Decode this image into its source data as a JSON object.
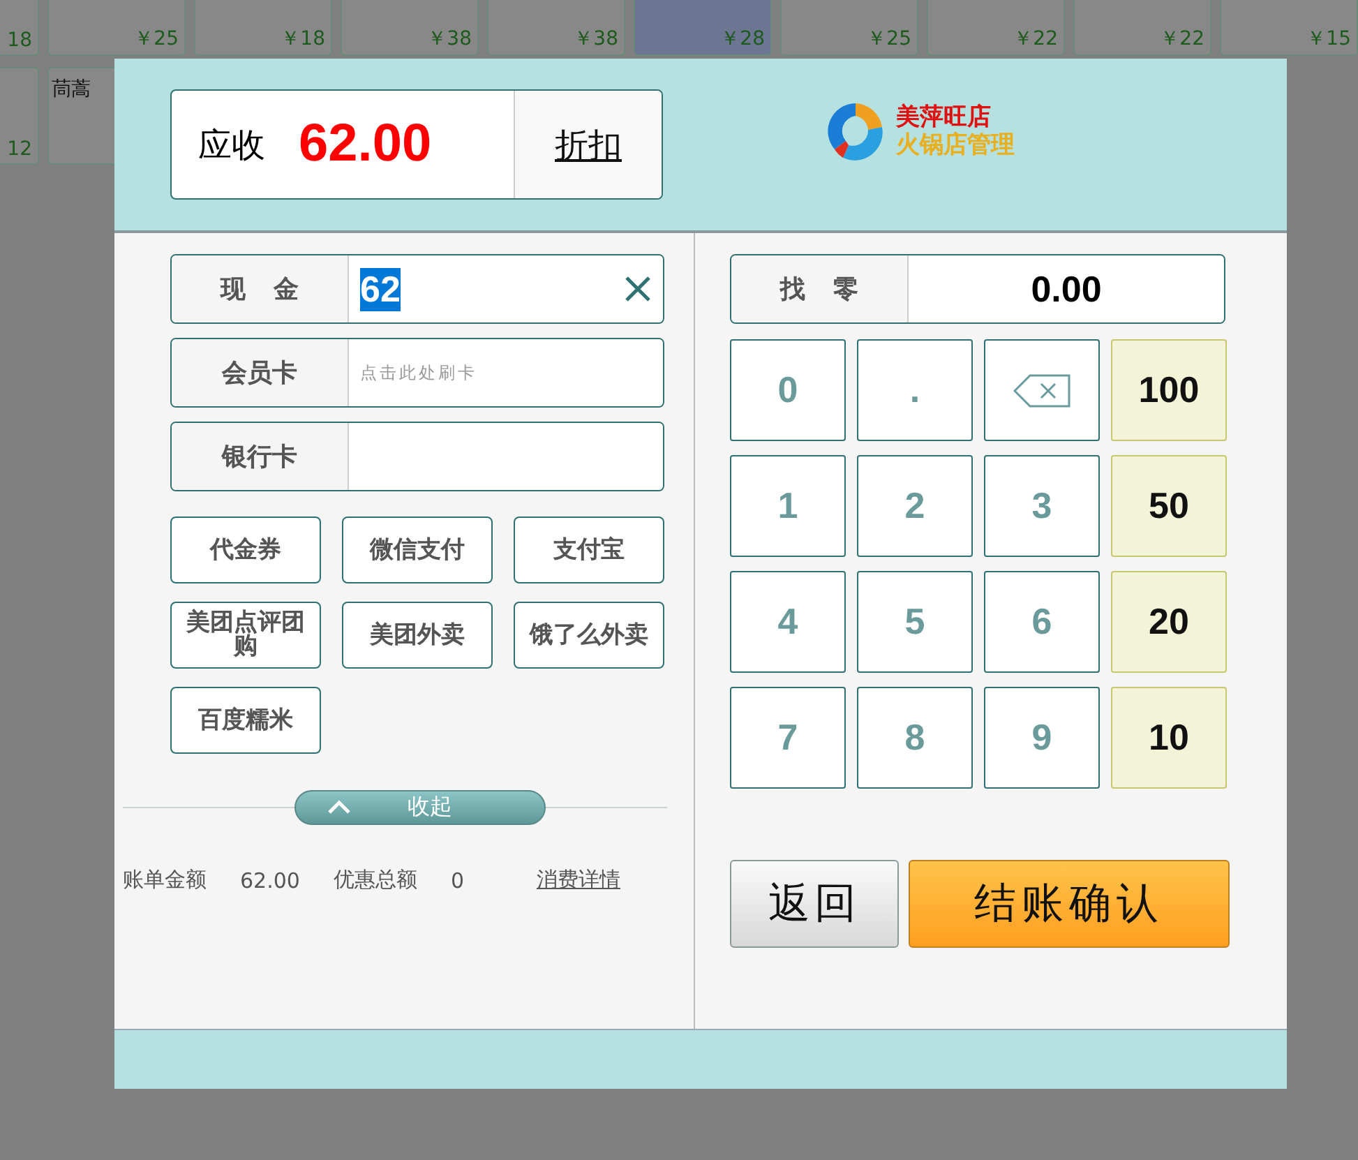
{
  "background_tiles": [
    [
      {
        "price": "18",
        "selected": false
      },
      {
        "price": "￥25",
        "selected": false
      },
      {
        "price": "￥18",
        "selected": false
      },
      {
        "price": "￥38",
        "selected": false
      },
      {
        "price": "￥38",
        "selected": false
      },
      {
        "price": "￥28",
        "selected": true
      },
      {
        "price": "￥25",
        "selected": false
      },
      {
        "price": "￥22",
        "selected": false
      },
      {
        "price": "￥22",
        "selected": false
      },
      {
        "price": "￥15",
        "selected": false
      }
    ],
    [
      {
        "price": "12",
        "selected": false
      },
      {
        "name": "茼蒿",
        "selected": false
      }
    ]
  ],
  "dialog": {
    "receivable": {
      "label": "应收",
      "amount": "62.00",
      "discount_button": "折扣"
    },
    "logo": {
      "line1": "美萍旺店",
      "line2": "火锅店管理"
    },
    "payment_fields": [
      {
        "label": "现 金",
        "value": "62",
        "value_selected": true,
        "clearable": true
      },
      {
        "label": "会员卡",
        "placeholder": "点击此处刷卡",
        "clearable": false
      },
      {
        "label": "银行卡",
        "clearable": false
      }
    ],
    "payment_methods": [
      "代金券",
      "微信支付",
      "支付宝",
      "美团点评团购",
      "美团外卖",
      "饿了么外卖",
      "百度糯米"
    ],
    "collapse_button": "收起",
    "summary": [
      {
        "label": "账单金额",
        "value": "62.00"
      },
      {
        "label": "优惠总额",
        "value": "0"
      }
    ],
    "detail_link": "消费详情",
    "change": {
      "label": "找 零",
      "value": "0.00"
    },
    "keypad": [
      [
        {
          "kind": "digit",
          "label": "0"
        },
        {
          "kind": "digit",
          "label": "."
        },
        {
          "kind": "backspace"
        },
        {
          "kind": "amount",
          "label": "100"
        }
      ],
      [
        {
          "kind": "digit",
          "label": "1"
        },
        {
          "kind": "digit",
          "label": "2"
        },
        {
          "kind": "digit",
          "label": "3"
        },
        {
          "kind": "amount",
          "label": "50"
        }
      ],
      [
        {
          "kind": "digit",
          "label": "4"
        },
        {
          "kind": "digit",
          "label": "5"
        },
        {
          "kind": "digit",
          "label": "6"
        },
        {
          "kind": "amount",
          "label": "20"
        }
      ],
      [
        {
          "kind": "digit",
          "label": "7"
        },
        {
          "kind": "digit",
          "label": "8"
        },
        {
          "kind": "digit",
          "label": "9"
        },
        {
          "kind": "amount",
          "label": "10"
        }
      ]
    ],
    "back_button": "返回",
    "confirm_button": "结账确认"
  }
}
